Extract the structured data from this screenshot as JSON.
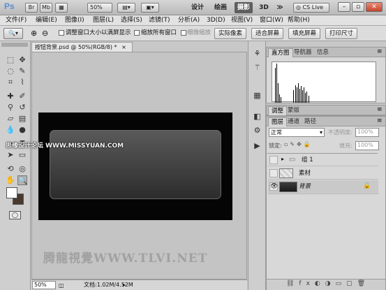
{
  "title_bar": {
    "app_logo": "Ps",
    "zoom": "50%",
    "workspaces": [
      "设计",
      "绘画",
      "摄影",
      "3D"
    ],
    "active_workspace": "摄影",
    "more": "≫",
    "cslive": "CS Live"
  },
  "menu": [
    "文件(F)",
    "编辑(E)",
    "图像(I)",
    "图层(L)",
    "选择(S)",
    "滤镜(T)",
    "分析(A)",
    "3D(D)",
    "视图(V)",
    "窗口(W)",
    "帮助(H)"
  ],
  "options": {
    "resize_windows": "调整窗口大小以满屏显示",
    "zoom_all": "缩放所有窗口",
    "scrubby_zoom": "细微缩放",
    "actual_pixels": "实际像素",
    "fit_screen": "适合屏幕",
    "fill_screen": "填充屏幕",
    "print_size": "打印尺寸"
  },
  "document": {
    "tab_title": "按钮背景.psd @ 50%(RGB/8) *",
    "zoom": "50%",
    "doc_info": "文档:1.02M/4.52M"
  },
  "watermarks": {
    "site_label": "思缘设计论坛 WWW.MISSYUAN.COM",
    "bottom_label": "腾龍視覺WWW.TLVI.NET"
  },
  "histogram_panel": {
    "tabs": [
      "直方图",
      "导航器",
      "信息"
    ],
    "active": "直方图"
  },
  "adjust_panel": {
    "tabs": [
      "调整",
      "蒙版"
    ],
    "active": "调整"
  },
  "layers_panel": {
    "tabs": [
      "图层",
      "通道",
      "路径"
    ],
    "active": "图层",
    "blend_mode": "正常",
    "opacity_label": "不透明度:",
    "opacity": "100%",
    "lock_label": "锁定:",
    "fill_label": "填充:",
    "fill": "100%",
    "layers": [
      {
        "name": "组 1"
      },
      {
        "name": "素材"
      },
      {
        "name": "背景"
      }
    ]
  },
  "colors": {
    "accent": "#5e5e5e",
    "close": "#c4452c"
  }
}
